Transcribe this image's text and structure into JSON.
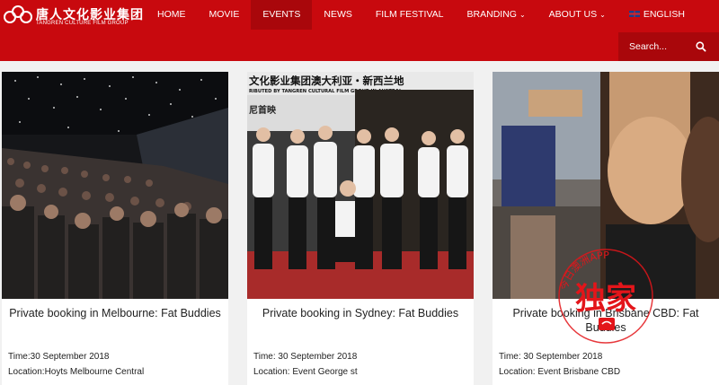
{
  "brand": {
    "name_cn": "唐人文化影业集团",
    "name_en": "TANGREN CULTURE FILM GROUP"
  },
  "nav": {
    "items": [
      {
        "label": "HOME"
      },
      {
        "label": "MOVIE"
      },
      {
        "label": "EVENTS",
        "active": true
      },
      {
        "label": "NEWS"
      },
      {
        "label": "FILM FESTIVAL"
      },
      {
        "label": "BRANDING"
      },
      {
        "label": "ABOUT US"
      },
      {
        "label": "ENGLISH"
      }
    ]
  },
  "search": {
    "placeholder": "Search..."
  },
  "events": [
    {
      "title": "Private booking in Melbourne: Fat Buddies",
      "time": "Time:30 September 2018",
      "location": "Location:Hoyts Melbourne Central",
      "image": "cinema-audience-photo"
    },
    {
      "title": "Private booking in Sydney: Fat Buddies",
      "time": "Time: 30 September 2018",
      "location": "Location: Event George st",
      "image": "group-photo-backdrop",
      "banner_cn": "文化影业集团澳大利亚・新西兰地",
      "banner_en": "RIBUTED BY TANGREN CULTURAL FILM GROUP IN AUSTRAL",
      "sign_cn": "尼首映"
    },
    {
      "title": "Private booking in Brisbane CBD: Fat Buddies",
      "time": "Time: 30 September 2018",
      "location": "Location: Event Brisbane CBD",
      "image": "poster-closeup-photo"
    }
  ],
  "watermark": {
    "arc_text": "今日澳洲APP",
    "main_text": "独家"
  },
  "colors": {
    "brand_red": "#c8090e",
    "active_red": "#a9070b",
    "page_bg": "#f1f1f1"
  },
  "icons": [
    "logo-rings-icon",
    "chevron-down-icon",
    "uk-flag-icon",
    "search-icon"
  ]
}
